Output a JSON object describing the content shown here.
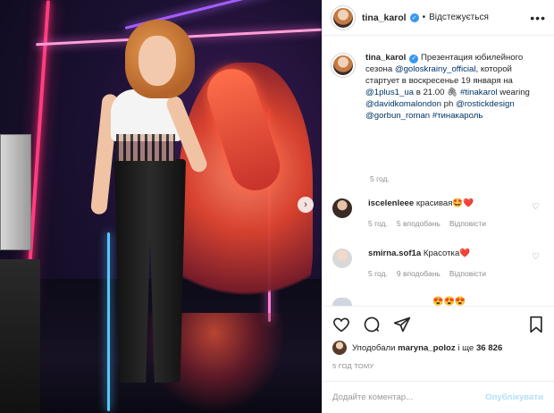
{
  "header": {
    "username": "tina_karol",
    "follow_status": "Відстежується",
    "more": "•••"
  },
  "caption": {
    "username": "tina_karol",
    "text_1": "Презентация юбилейного сезона",
    "mention_1": "@goloskrainy_official",
    "text_2": ", которой стартует в воскресенье 19 января на",
    "mention_2": "@1plus1_ua",
    "text_3": "в 21.00 🖇",
    "hashtag_1": "#tinakarol",
    "text_4": "wearing",
    "mention_3": "@davidkomalondon",
    "text_5": "ph",
    "mention_4": "@rostickdesign",
    "mention_5": "@gorbun_roman",
    "hashtag_2": "#тинакароль",
    "time": "5 год."
  },
  "comments": [
    {
      "username": "iscelenleee",
      "text": "красивая🤩❤️",
      "time": "5 год.",
      "likes": "5 вподобань",
      "reply": "Відповісти"
    },
    {
      "username": "smirna.sof1a",
      "text": "Красотка❤️",
      "time": "5 год.",
      "likes": "9 вподобань",
      "reply": "Відповісти"
    }
  ],
  "partial_comment": {
    "emojis": "😍😍😍"
  },
  "likes": {
    "prefix": "Уподобали",
    "user": "maryna_poloz",
    "middle": "і ще",
    "count": "36 826"
  },
  "ago": "5 ГОД ТОМУ",
  "add_comment": {
    "placeholder": "Додайте коментар...",
    "post_label": "Опублікувати"
  },
  "icons": [
    "heart-icon",
    "comment-icon",
    "share-icon",
    "bookmark-icon",
    "verified-icon",
    "more-icon",
    "chevron-right-icon"
  ],
  "colors": {
    "link": "#003569",
    "verified": "#3897f0",
    "muted": "#8e8e8e",
    "post_disabled": "#b2dffc"
  }
}
